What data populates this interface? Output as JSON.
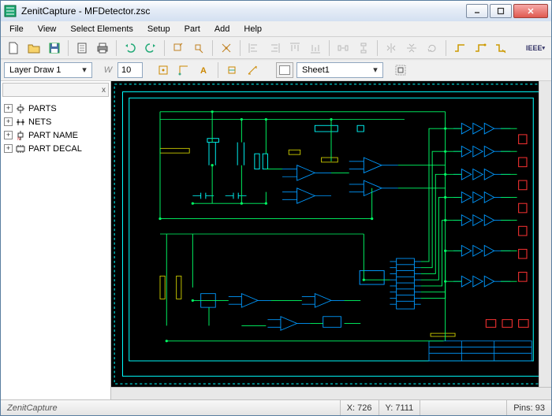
{
  "window": {
    "title": "ZenitCapture - MFDetector.zsc",
    "buttons": {
      "minimize": "_",
      "maximize": "□",
      "close": "X"
    }
  },
  "menubar": [
    "File",
    "View",
    "Select Elements",
    "Setup",
    "Part",
    "Add",
    "Help"
  ],
  "toolbar1_icons": [
    "new",
    "open",
    "save",
    "sep",
    "doc",
    "print",
    "sep",
    "undo",
    "redo",
    "sep",
    "zoom-in",
    "zoom-out",
    "sep",
    "cursor",
    "sep",
    "align-left",
    "align-right",
    "align-top",
    "align-bottom",
    "sep",
    "dist-h",
    "dist-v",
    "sep",
    "mirror-h",
    "mirror-v",
    "rotate",
    "sep",
    "route-a",
    "route-b",
    "route-c",
    "sep",
    "ieee"
  ],
  "toolbar2": {
    "layer_combo": "Layer Draw 1",
    "width_label": "W",
    "width_value": "10",
    "mode_icons": [
      "mode-a",
      "mode-b",
      "mode-c",
      "sep",
      "tool-d",
      "tool-e"
    ],
    "sheet_label": "Sheet1",
    "sheet_action_icon": "sheet-action"
  },
  "tree": {
    "close_label": "x",
    "nodes": [
      {
        "expander": "+",
        "icon": "parts-icon",
        "label": "PARTS"
      },
      {
        "expander": "+",
        "icon": "nets-icon",
        "label": "NETS"
      },
      {
        "expander": "+",
        "icon": "partname-icon",
        "label": "PART NAME"
      },
      {
        "expander": "+",
        "icon": "partdecal-icon",
        "label": "PART DECAL"
      }
    ]
  },
  "status": {
    "app": "ZenitCapture",
    "x_label": "X:",
    "x_value": "726",
    "y_label": "Y:",
    "y_value": "7111",
    "pins_label": "Pins:",
    "pins_value": "93"
  }
}
